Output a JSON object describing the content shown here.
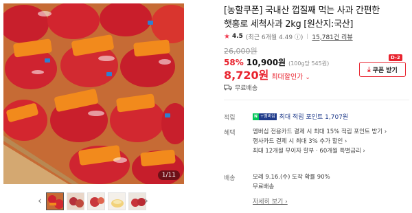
{
  "product": {
    "title": "[농할쿠폰] 국내산 껍질째 먹는 사과 간편한 햇홍로 세척사과 2kg [원산지:국산]"
  },
  "rating": {
    "score": "4.5",
    "recent": "(최근 6개월 4.49 ⓘ)",
    "reviews": "15,781건 리뷰"
  },
  "price": {
    "original": "26,000원",
    "discount_rate": "58%",
    "sale_price": "10,900원",
    "unit_price": "(100g당 545원)",
    "max_discount_price": "8,720원",
    "max_discount_label": "최대할인가",
    "chevron": "⌄"
  },
  "coupon": {
    "badge": "D-2",
    "label": "쿠폰 받기",
    "icon": "download-icon"
  },
  "shipping": {
    "free_label": "무료배송"
  },
  "points": {
    "label": "적립",
    "badge_n": "N",
    "badge_membership": "+멤버십",
    "text": "최대 적립 포인트 1,707원"
  },
  "benefits": {
    "label": "혜택",
    "items": [
      "멤버십 전용카드 결제 시 최대 15% 적립 포인트 받기 ›",
      "행사카드 결제 시 최대 3% 추가 할인 ›",
      "최대 12개월 무이자 할부 · 60개월 특별금리 ›"
    ]
  },
  "delivery": {
    "label": "배송",
    "eta": "모레 9.16.(수) 도착 확률 90%",
    "fee": "무료배송",
    "more_link": "자세히 보기 ›"
  },
  "gallery": {
    "counter": "1/11",
    "prev_arrow": "‹",
    "next_arrow": "›",
    "thumbnail_count": 5
  },
  "colors": {
    "accent_red": "#e8242f",
    "naver_green": "#03c75a",
    "membership_navy": "#1e3a8a"
  }
}
